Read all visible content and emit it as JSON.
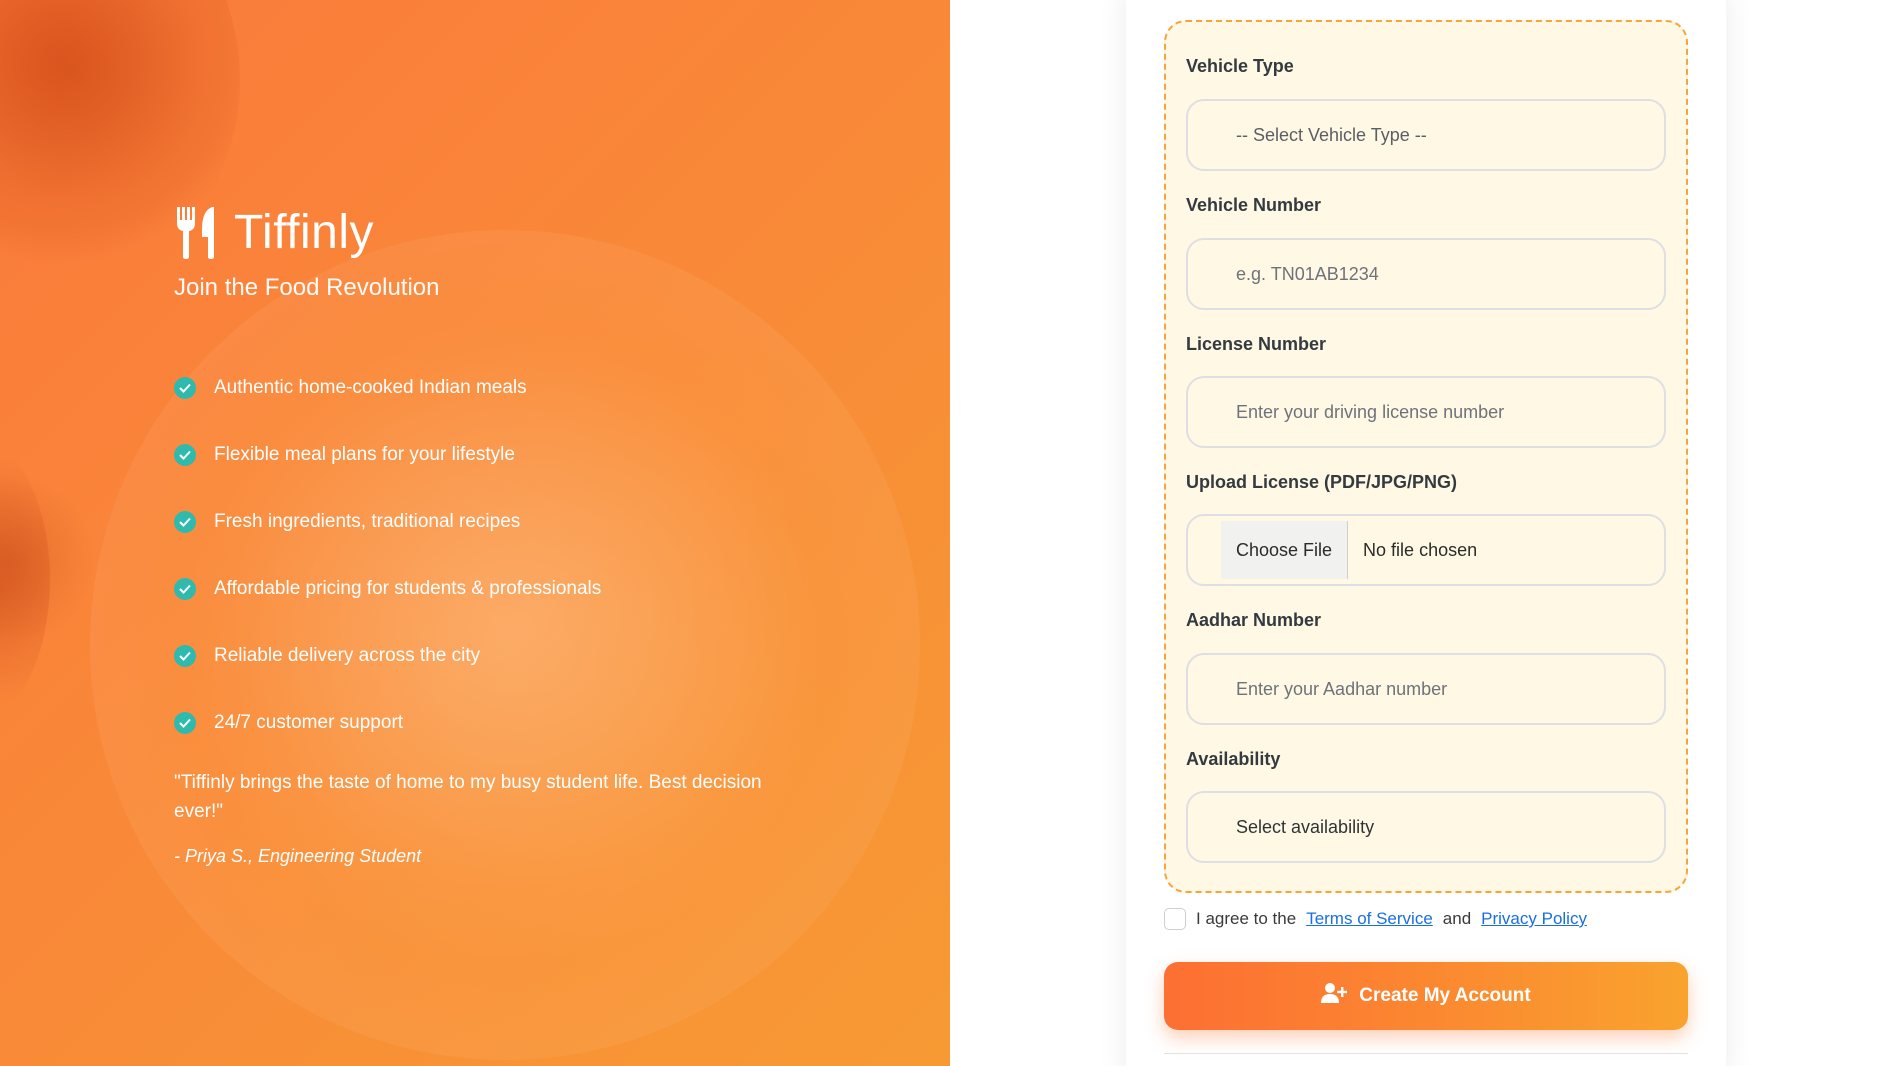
{
  "hero": {
    "brand_name": "Tiffinly",
    "tagline": "Join the Food Revolution",
    "features": [
      "Authentic home-cooked Indian meals",
      "Flexible meal plans for your lifestyle",
      "Fresh ingredients, traditional recipes",
      "Affordable pricing for students & professionals",
      "Reliable delivery across the city",
      "24/7 customer support"
    ],
    "testimonial": "\"Tiffinly brings the taste of home to my busy student life. Best decision ever!\"",
    "testimonial_author": "- Priya S., Engineering Student",
    "icons": {
      "brand": "utensils-icon",
      "feature": "check-circle-icon"
    },
    "colors": {
      "overlay_start": "#fb7a3c",
      "overlay_end": "#f79a34",
      "check": "#30b9ad"
    }
  },
  "form": {
    "vehicle_type": {
      "label": "Vehicle Type",
      "selected": "-- Select Vehicle Type --"
    },
    "vehicle_number": {
      "label": "Vehicle Number",
      "placeholder": "e.g. TN01AB1234"
    },
    "license_number": {
      "label": "License Number",
      "placeholder": "Enter your driving license number"
    },
    "upload_license": {
      "label": "Upload License (PDF/JPG/PNG)",
      "button": "Choose File",
      "status": "No file chosen"
    },
    "aadhar_number": {
      "label": "Aadhar Number",
      "placeholder": "Enter your Aadhar number"
    },
    "availability": {
      "label": "Availability",
      "selected": "Select availability"
    },
    "agree": {
      "prefix": "I agree to the",
      "terms": "Terms of Service",
      "conjunction": "and",
      "privacy": "Privacy Policy",
      "checked": false
    },
    "submit_label": "Create My Account",
    "colors": {
      "accent": "#fb8a30",
      "section_bg": "#fff8e4",
      "section_border": "#f7a43a",
      "link": "#1a6fe0"
    }
  }
}
